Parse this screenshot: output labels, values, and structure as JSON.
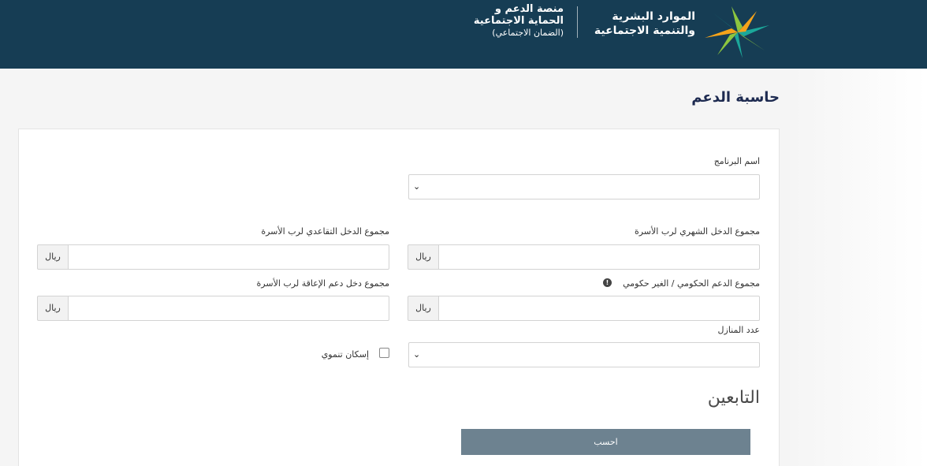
{
  "header": {
    "ministry_line1": "الموارد البشرية",
    "ministry_line2": "والتنمية الاجتماعية",
    "platform_line1": "منصة الدعم و",
    "platform_line2": "الحماية الاجتماعية",
    "platform_line3": "(الضمان الاجتماعي)",
    "logo_icon": "ministry-logo-icon"
  },
  "page": {
    "title": "حاسبة الدعم"
  },
  "form": {
    "program_name_label": "اسم البرنامج",
    "program_name_value": "",
    "monthly_income_label": "مجموع الدخل الشهري لرب الأسرة",
    "retirement_income_label": "مجموع الدخل التقاعدي لرب الأسرة",
    "gov_support_label": "مجموع الدعم الحكومي / الغير حكومي",
    "disability_income_label": "مجموع دخل دعم الإعاقة لرب الأسرة",
    "currency": "ريال",
    "homes_count_label": "عدد المنازل",
    "homes_count_value": "",
    "housing_label": "إسكان تنموي",
    "housing_checked": false
  },
  "dependents": {
    "title": "التابعين"
  },
  "actions": {
    "calculate_label": "احسب"
  },
  "colors": {
    "header_bg": "#163d54",
    "button_bg": "#6d8290",
    "logo_orange": "#f5a31a",
    "logo_green": "#8cc63f",
    "logo_teal": "#1ba89a"
  }
}
